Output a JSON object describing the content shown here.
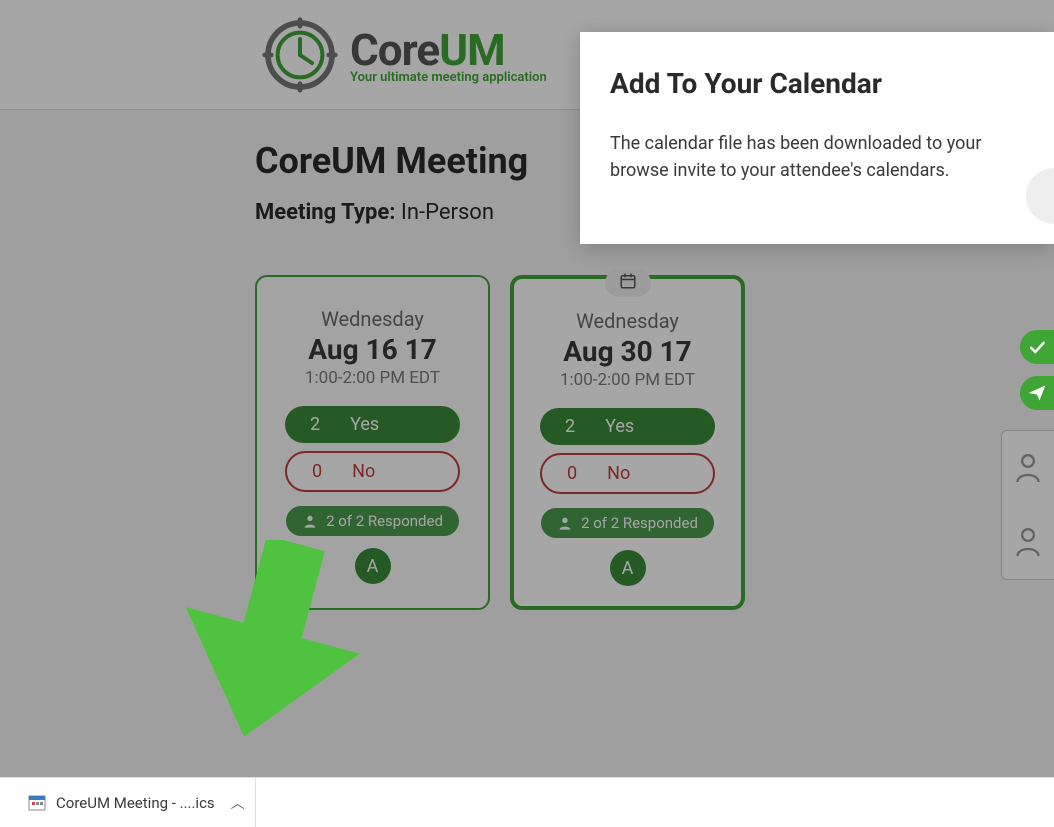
{
  "brand": {
    "name_part1": "Core",
    "name_part2": "UM",
    "tagline": "Your ultimate meeting application",
    "accent_color": "#3fa535"
  },
  "page": {
    "title": "CoreUM Meeting",
    "meeting_type_label": "Meeting Type:",
    "meeting_type_value": "In-Person"
  },
  "date_options": [
    {
      "day": "Wednesday",
      "date": "Aug 16 17",
      "time": "1:00-2:00 PM EDT",
      "yes_count": "2",
      "yes_label": "Yes",
      "no_count": "0",
      "no_label": "No",
      "responded": "2 of 2 Responded",
      "avatar_initial": "A",
      "selected": false
    },
    {
      "day": "Wednesday",
      "date": "Aug 30 17",
      "time": "1:00-2:00 PM EDT",
      "yes_count": "2",
      "yes_label": "Yes",
      "no_count": "0",
      "no_label": "No",
      "responded": "2 of 2 Responded",
      "avatar_initial": "A",
      "selected": true
    }
  ],
  "popup": {
    "title": "Add To Your Calendar",
    "body": "The calendar file has been downloaded to your browse invite to your attendee's calendars."
  },
  "download": {
    "filename": "CoreUM Meeting - ....ics"
  },
  "icons": {
    "calendar": "calendar-icon",
    "check": "check-icon",
    "send": "send-icon",
    "person": "person-icon"
  }
}
